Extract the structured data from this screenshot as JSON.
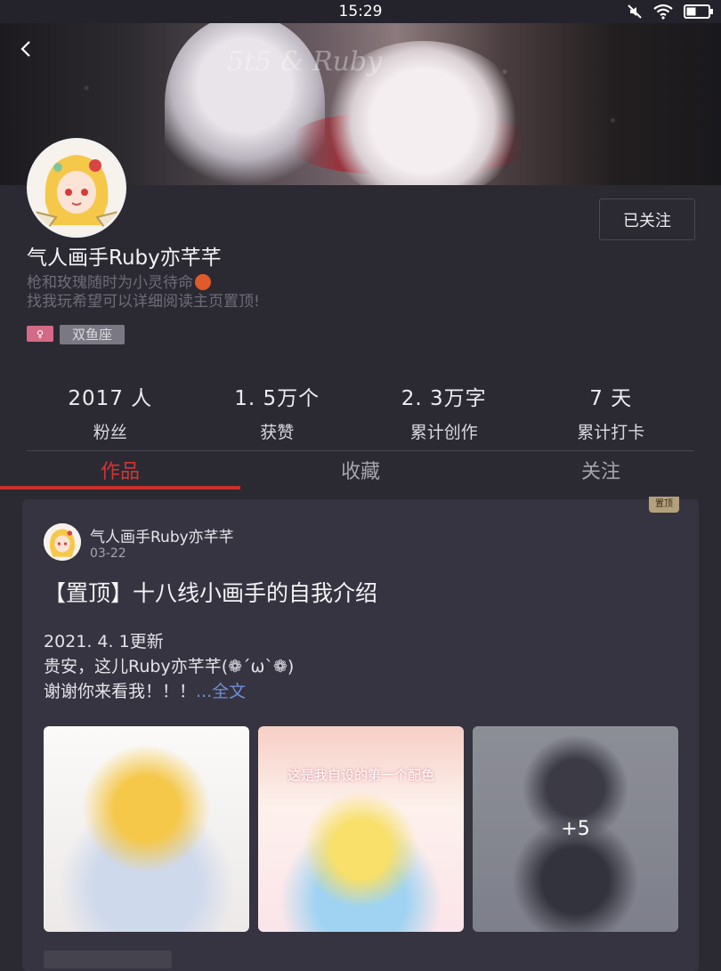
{
  "status_bar": {
    "time": "15:29"
  },
  "banner": {
    "signature": "5t5 & Ruby"
  },
  "profile": {
    "follow_button": "已关注",
    "username": "气人画手Ruby亦芊芊",
    "bio_line1": "枪和玫瑰随时为小灵待命",
    "bio_line2": "找我玩希望可以详细阅读主页置顶!",
    "tag": "双鱼座"
  },
  "stats": [
    {
      "value": "2017 人",
      "label": "粉丝"
    },
    {
      "value": "1. 5万个",
      "label": "获赞"
    },
    {
      "value": "2. 3万字",
      "label": "累计创作"
    },
    {
      "value": "7 天",
      "label": "累计打卡"
    }
  ],
  "tabs": [
    {
      "label": "作品",
      "active": true
    },
    {
      "label": "收藏",
      "active": false
    },
    {
      "label": "关注",
      "active": false
    }
  ],
  "post": {
    "pin_badge": "置顶",
    "author": "气人画手Ruby亦芊芊",
    "date": "03-22",
    "title": "【置顶】十八线小画手的自我介绍",
    "body_line1": "2021. 4. 1更新",
    "body_line2": "贵安，这儿Ruby亦芊芊(❁´ω`❁)",
    "body_line3": "谢谢你来看我！！！",
    "ellipsis": "...",
    "more_link": "全文",
    "thumb2_caption": "这是我自设的第一个配色",
    "more_images": "+5"
  },
  "colors": {
    "accent": "#d5342f",
    "link": "#6f8fd4",
    "background": "#2b2a33",
    "card": "#353440"
  }
}
